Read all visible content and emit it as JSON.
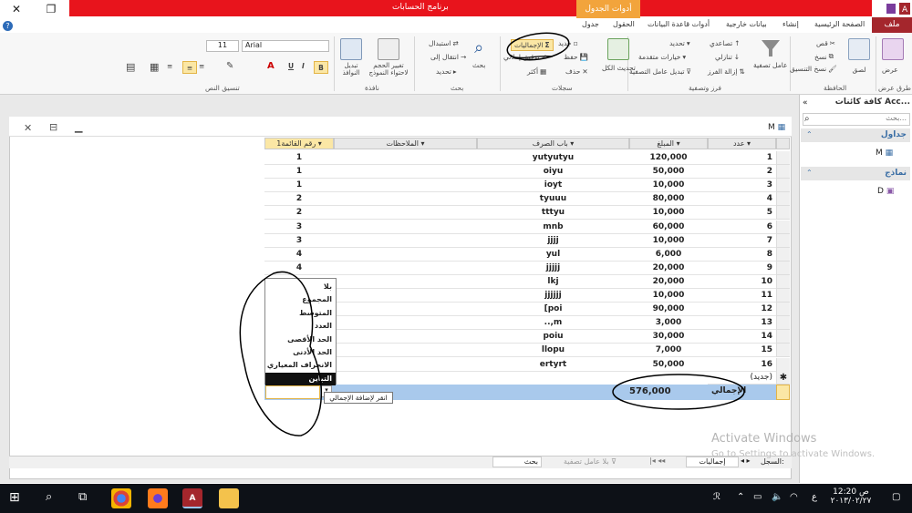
{
  "window": {
    "title": "برنامج الحسابات",
    "context_tab": "أدوات الجدول",
    "context_sub": "جدول",
    "file_tab": "ملف"
  },
  "tabs": [
    "الصفحة الرئيسية",
    "إنشاء",
    "بيانات خارجية",
    "أدوات قاعدة البيانات",
    "الحقول"
  ],
  "ribbon": {
    "groups": [
      "طرق عرض",
      "الحافظة",
      "فرز وتصفية",
      "سجلات",
      "بحث",
      "نافذة",
      "تنسيق النص"
    ],
    "view": "عرض",
    "paste": "لصق",
    "cut": "قص",
    "copy": "نسخ",
    "format_painter": "نسخ التنسيق",
    "filter": "عامل تصفية",
    "ascending": "تصاعدي",
    "descending": "تنازلي",
    "remove_sort": "إزالة الفرز",
    "selection": "تحديد",
    "advanced": "خيارات متقدمة",
    "toggle_filter": "تبديل عامل التصفية",
    "new": "جديد",
    "save": "حفظ",
    "delete": "حذف",
    "totals": "الإجماليات",
    "spelling": "تدقيق إملائي",
    "more": "أكثر",
    "refresh_all": "تحديث الكل",
    "find": "بحث",
    "replace": "استبدال",
    "goto": "انتقال إلى",
    "select": "تحديد",
    "size_to_fit": "تغيير الحجم لاحتواء النموذج",
    "switch_windows": "تبديل النوافذ",
    "font": "Arial",
    "font_size": "11"
  },
  "nav": {
    "title": "كافة كائنات Acc...",
    "search_placeholder": "بحث...",
    "section_tables": "جداول",
    "section_forms": "نماذج",
    "table_item": "M",
    "form_item": "D"
  },
  "doc": {
    "tab": "M"
  },
  "grid": {
    "columns": [
      "عدد",
      "المبلغ",
      "باب الصرف",
      "الملاحظات",
      "رقم القائمة1"
    ],
    "rows": [
      {
        "n": "1",
        "amount": "120,000",
        "cat": "yutyutyu",
        "list": "1"
      },
      {
        "n": "2",
        "amount": "50,000",
        "cat": "oiyu",
        "list": "1"
      },
      {
        "n": "3",
        "amount": "10,000",
        "cat": "ioyt",
        "list": "1"
      },
      {
        "n": "4",
        "amount": "80,000",
        "cat": "tyuuu",
        "list": "2"
      },
      {
        "n": "5",
        "amount": "10,000",
        "cat": "tttyu",
        "list": "2"
      },
      {
        "n": "6",
        "amount": "60,000",
        "cat": "mnb",
        "list": "3"
      },
      {
        "n": "7",
        "amount": "10,000",
        "cat": "jjjj",
        "list": "3"
      },
      {
        "n": "8",
        "amount": "6,000",
        "cat": "yul",
        "list": "4"
      },
      {
        "n": "9",
        "amount": "20,000",
        "cat": "jjjjj",
        "list": "4"
      },
      {
        "n": "10",
        "amount": "20,000",
        "cat": "lkj",
        "list": ""
      },
      {
        "n": "11",
        "amount": "10,000",
        "cat": "jjjjjj",
        "list": ""
      },
      {
        "n": "12",
        "amount": "90,000",
        "cat": "[poi",
        "list": ""
      },
      {
        "n": "13",
        "amount": "3,000",
        "cat": "..,m",
        "list": ""
      },
      {
        "n": "14",
        "amount": "30,000",
        "cat": "poiu",
        "list": ""
      },
      {
        "n": "15",
        "amount": "7,000",
        "cat": "llopu",
        "list": ""
      },
      {
        "n": "16",
        "amount": "50,000",
        "cat": "ertyrt",
        "list": ""
      }
    ],
    "new_row": "(جديد)",
    "total_label": "الإجمالي",
    "total_value": "576,000"
  },
  "dropdown": {
    "items": [
      "بلا",
      "المجموع",
      "المتوسط",
      "العدد",
      "الحد الأقصى",
      "الحد الأدنى",
      "الانحراف المعياري",
      "التباين"
    ],
    "selected_index": 7
  },
  "tooltip": "انقر لإضافة الإجمالي",
  "statusbar": {
    "record_label": "السجل:",
    "record_value": "إجماليات",
    "no_filter": "بلا عامل تصفية",
    "search": "بحث"
  },
  "watermark": {
    "line1": "Activate Windows",
    "line2": "Go to Settings to activate Windows."
  },
  "taskbar": {
    "time": "12:20 ص",
    "date": "٢٠١٣/٠٢/٢٧",
    "lang": "ع"
  },
  "colors": {
    "title_red": "#e8141c",
    "context_orange": "#f2a43c",
    "total_row_blue": "#a9c9ec",
    "file_tab": "#a4262c"
  }
}
